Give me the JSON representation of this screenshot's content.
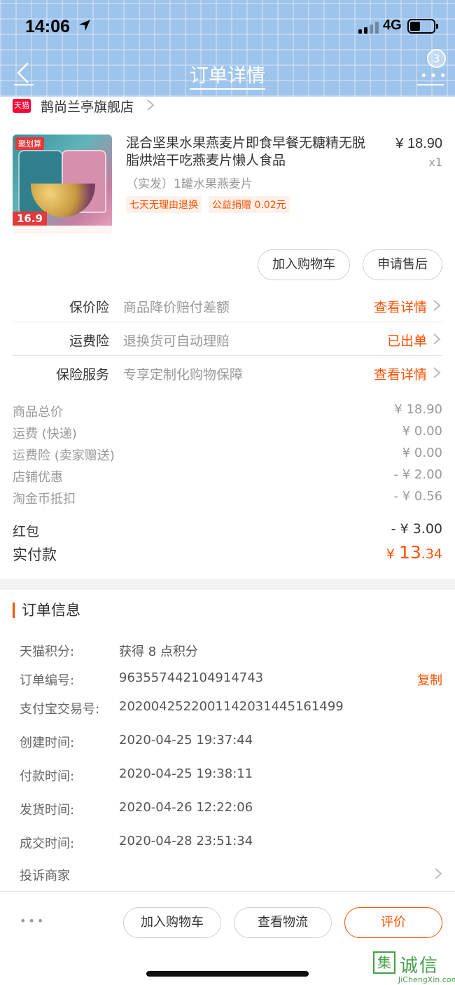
{
  "status_bar": {
    "time": "14:06",
    "network": "4G"
  },
  "nav": {
    "title": "订单详情",
    "badge": "3"
  },
  "store": {
    "logo": "天猫",
    "name": "鹊尚兰亭旗舰店"
  },
  "product": {
    "title": "混合坚果水果燕麦片即食早餐无糖精无脱脂烘焙干吃燕麦片懒人食品",
    "price": "¥ 18.90",
    "qty": "x1",
    "sku": "（实发）1罐水果燕麦片",
    "tags": [
      "七天无理由退换",
      "公益捐赠 0.02元"
    ],
    "thumb_tag": "聚划算",
    "thumb_price": "16.9"
  },
  "actions": {
    "add_cart": "加入购物车",
    "after_sale": "申请售后"
  },
  "insurance": [
    {
      "label": "保价险",
      "desc": "商品降价赔付差额",
      "action": "查看详情"
    },
    {
      "label": "运费险",
      "desc": "退换货可自动理赔",
      "action": "已出单"
    },
    {
      "label": "保险服务",
      "desc": "专享定制化购物保障",
      "action": "查看详情"
    }
  ],
  "summary": [
    {
      "label": "商品总价",
      "value": "¥ 18.90"
    },
    {
      "label": "运费 (快递)",
      "value": "¥ 0.00"
    },
    {
      "label": "运费险 (卖家赠送)",
      "value": "¥ 0.00"
    },
    {
      "label": "店铺优惠",
      "value": "- ¥ 2.00"
    },
    {
      "label": "淘金币抵扣",
      "value": "- ¥ 0.56"
    }
  ],
  "hongbao": {
    "label": "红包",
    "value": "- ¥ 3.00"
  },
  "paid": {
    "label": "实付款",
    "currency": "¥",
    "int": "13",
    "dec": ".34"
  },
  "order_info": {
    "title": "订单信息",
    "rows": [
      {
        "key": "天猫积分:",
        "value": "获得 8 点积分"
      },
      {
        "key": "订单编号:",
        "value": "963557442104914743",
        "action": "复制"
      },
      {
        "key": "支付宝交易号:",
        "value": "2020042522001142031445161499"
      },
      {
        "key": "创建时间:",
        "value": "2020-04-25 19:37:44"
      },
      {
        "key": "付款时间:",
        "value": "2020-04-25 19:38:11"
      },
      {
        "key": "发货时间:",
        "value": "2020-04-26 12:22:06"
      },
      {
        "key": "成交时间:",
        "value": "2020-04-28 23:51:34"
      }
    ],
    "complain": "投诉商家"
  },
  "bottom": {
    "more": "•••",
    "add_cart": "加入购物车",
    "logistics": "查看物流",
    "review": "评价"
  },
  "watermark": {
    "mark": "集",
    "cn": "诚信",
    "en": "JiChengXin.com"
  },
  "colors": {
    "accent": "#ff5000",
    "header": "#9fc4ec",
    "tmall": "#ff0036"
  }
}
